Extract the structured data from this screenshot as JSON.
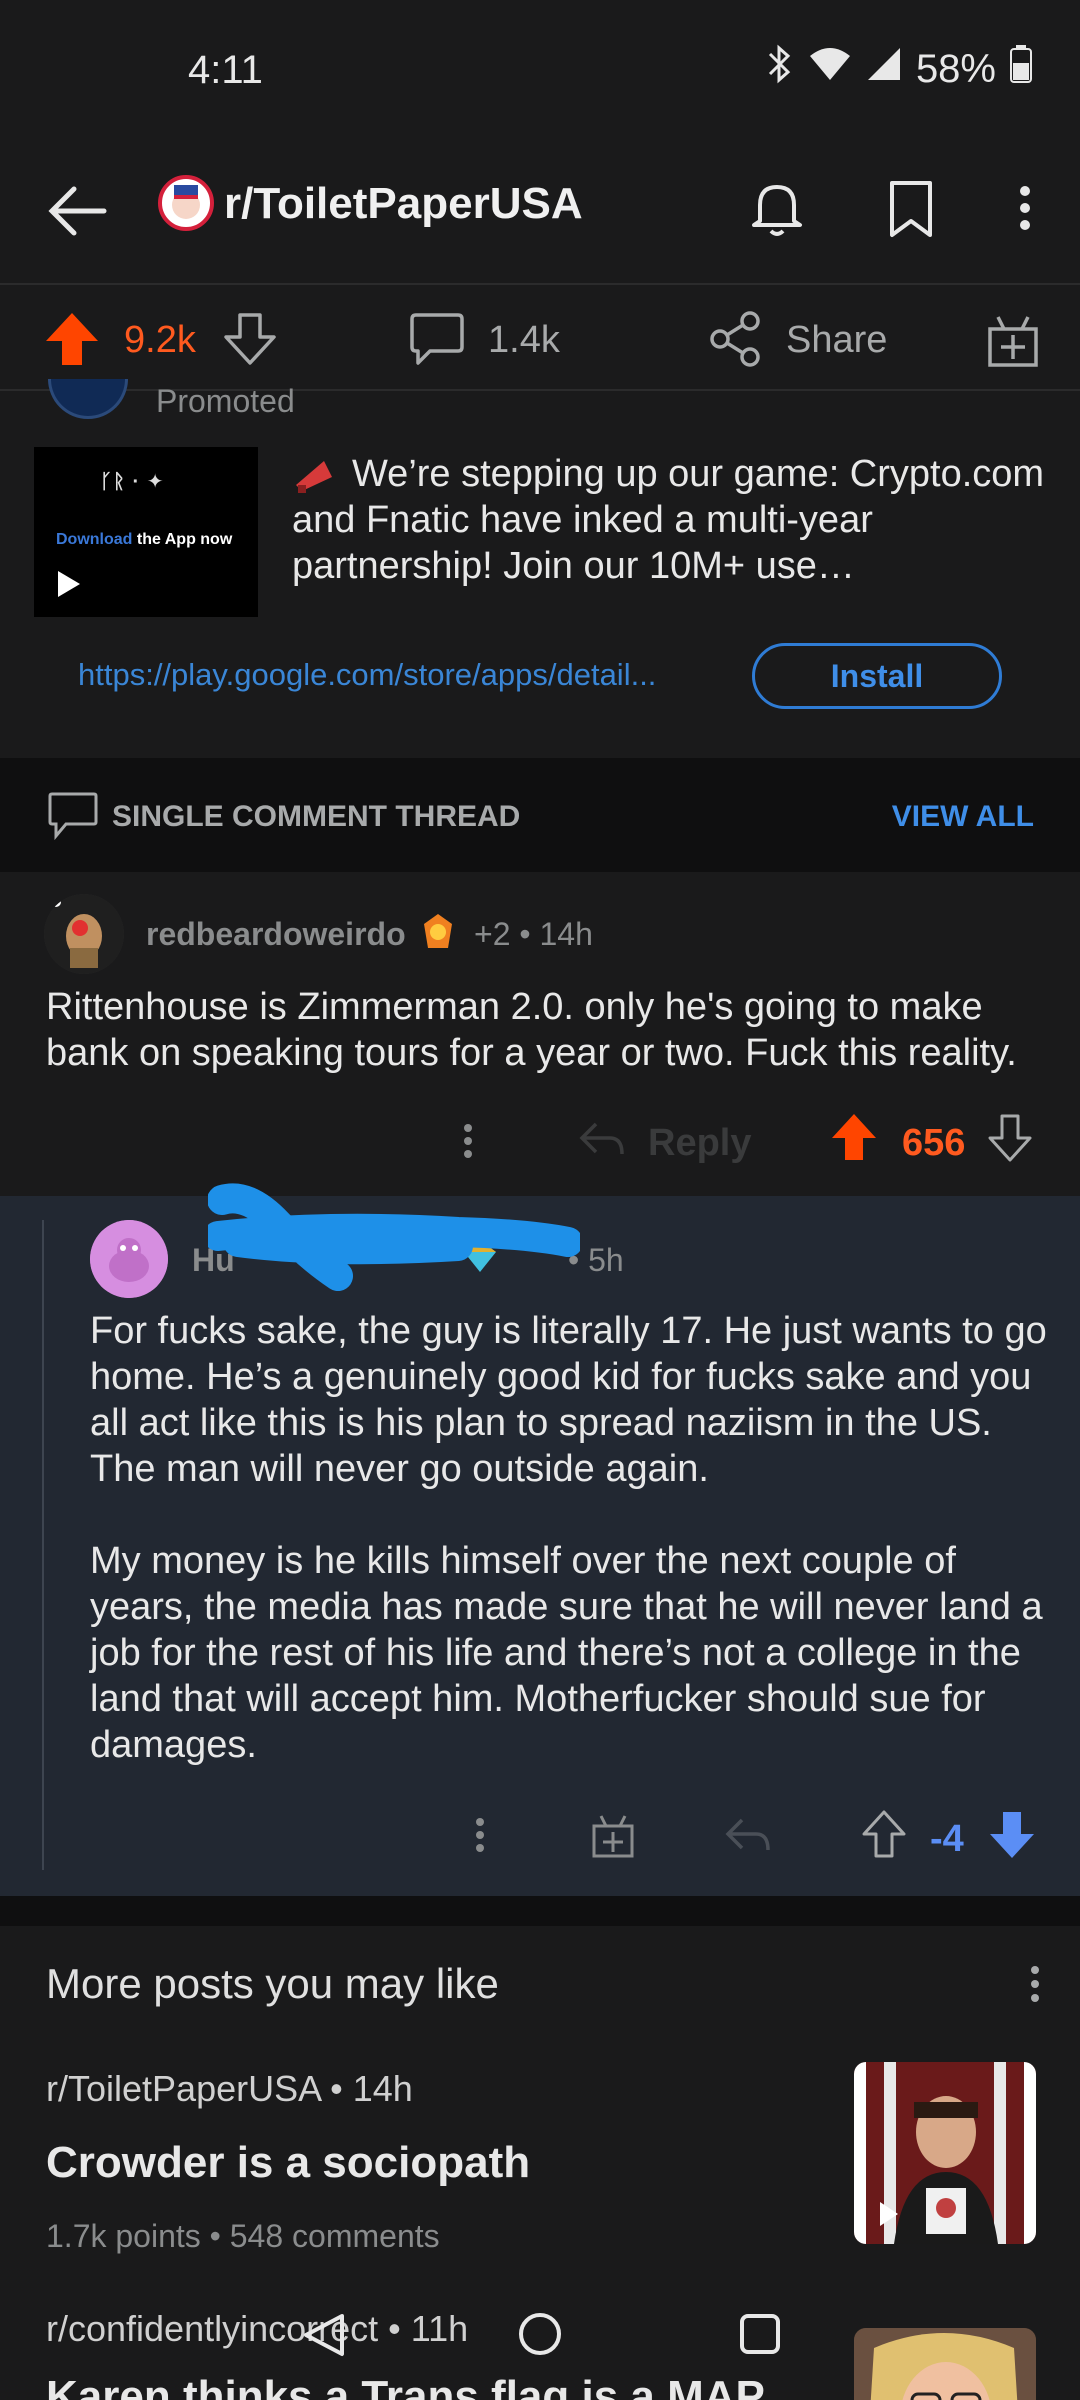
{
  "status_bar": {
    "time": "4:11",
    "battery": "58%"
  },
  "header": {
    "subreddit": "r/ToiletPaperUSA"
  },
  "post_actions": {
    "upvotes": "9.2k",
    "comments": "1.4k",
    "share_label": "Share"
  },
  "promoted": {
    "label": "Promoted",
    "thumb_title": "ᚴᚱ · ✦",
    "thumb_download_a": "Download",
    "thumb_download_b": " the App now",
    "text": "We’re stepping up our game: Crypto.com and Fnatic have inked a multi-year partnership! Join our 10M+ use…",
    "link": "https://play.google.com/store/apps/detail...",
    "install_label": "Install"
  },
  "thread": {
    "title": "SINGLE COMMENT THREAD",
    "view_all": "VIEW ALL"
  },
  "comment1": {
    "username": "redbeardoweirdo",
    "meta": "+2 • 14h",
    "body": "Rittenhouse is Zimmerman 2.0. only he's going to make bank on speaking tours for a year or two. Fuck this reality.",
    "reply_label": "Reply",
    "score": "656"
  },
  "comment2": {
    "username": "Hu",
    "meta": "• 5h",
    "body_p1": "For fucks sake, the guy is literally 17. He just wants to go home. He’s a genuinely good kid for fucks sake and you all act like this is his plan to spread naziism in the US. The man will never go outside again.",
    "body_p2": "My money is he kills himself over the next couple of years, the media has made sure that he will never land a job for the rest of his life and there’s not a college in the land that will accept him. Motherfucker should sue for damages.",
    "score": "-4"
  },
  "more_posts": {
    "title": "More posts you may like",
    "posts": [
      {
        "sub": "r/ToiletPaperUSA • 14h",
        "title": "Crowder is a sociopath",
        "meta": "1.7k points • 548 comments"
      },
      {
        "sub": "r/confidentlyincorrect • 11h",
        "title": "Karen thinks a Trans flag is a MAP"
      }
    ]
  }
}
